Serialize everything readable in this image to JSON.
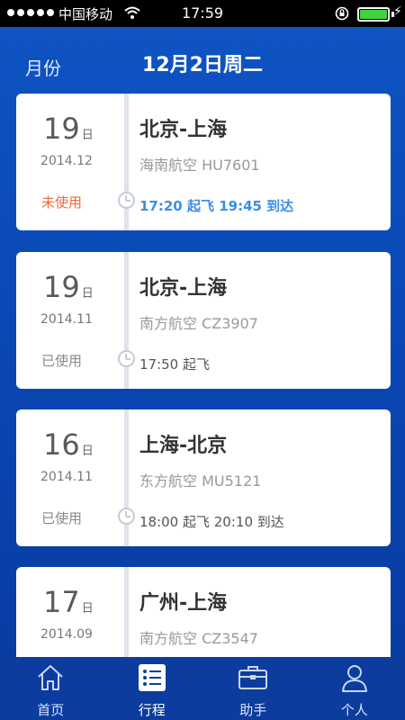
{
  "status_bar": {
    "carrier": "中国移动",
    "time": "17:59"
  },
  "nav": {
    "month_button": "月份",
    "title": "12月2日周二"
  },
  "trips": [
    {
      "day": "19",
      "day_unit": "日",
      "year_month": "2014.12",
      "status": "未使用",
      "route": "北京-上海",
      "flight": "海南航空 HU7601",
      "times": "17:20 起飞 19:45 到达"
    },
    {
      "day": "19",
      "day_unit": "日",
      "year_month": "2014.11",
      "status": "已使用",
      "route": "北京-上海",
      "flight": "南方航空 CZ3907",
      "times": "17:50 起飞"
    },
    {
      "day": "16",
      "day_unit": "日",
      "year_month": "2014.11",
      "status": "已使用",
      "route": "上海-北京",
      "flight": "东方航空 MU5121",
      "times": "18:00 起飞 20:10 到达"
    },
    {
      "day": "17",
      "day_unit": "日",
      "year_month": "2014.09",
      "status": "",
      "route": "广州-上海",
      "flight": "南方航空 CZ3547",
      "times": ""
    }
  ],
  "tabs": [
    {
      "label": "首页",
      "icon": "home-icon"
    },
    {
      "label": "行程",
      "icon": "itinerary-icon"
    },
    {
      "label": "助手",
      "icon": "briefcase-icon"
    },
    {
      "label": "个人",
      "icon": "user-icon"
    }
  ],
  "colors": {
    "background": "#0a48b5",
    "unused_status": "#ee6a3c",
    "active_times": "#3a8fe6",
    "battery": "#3fd43f"
  }
}
